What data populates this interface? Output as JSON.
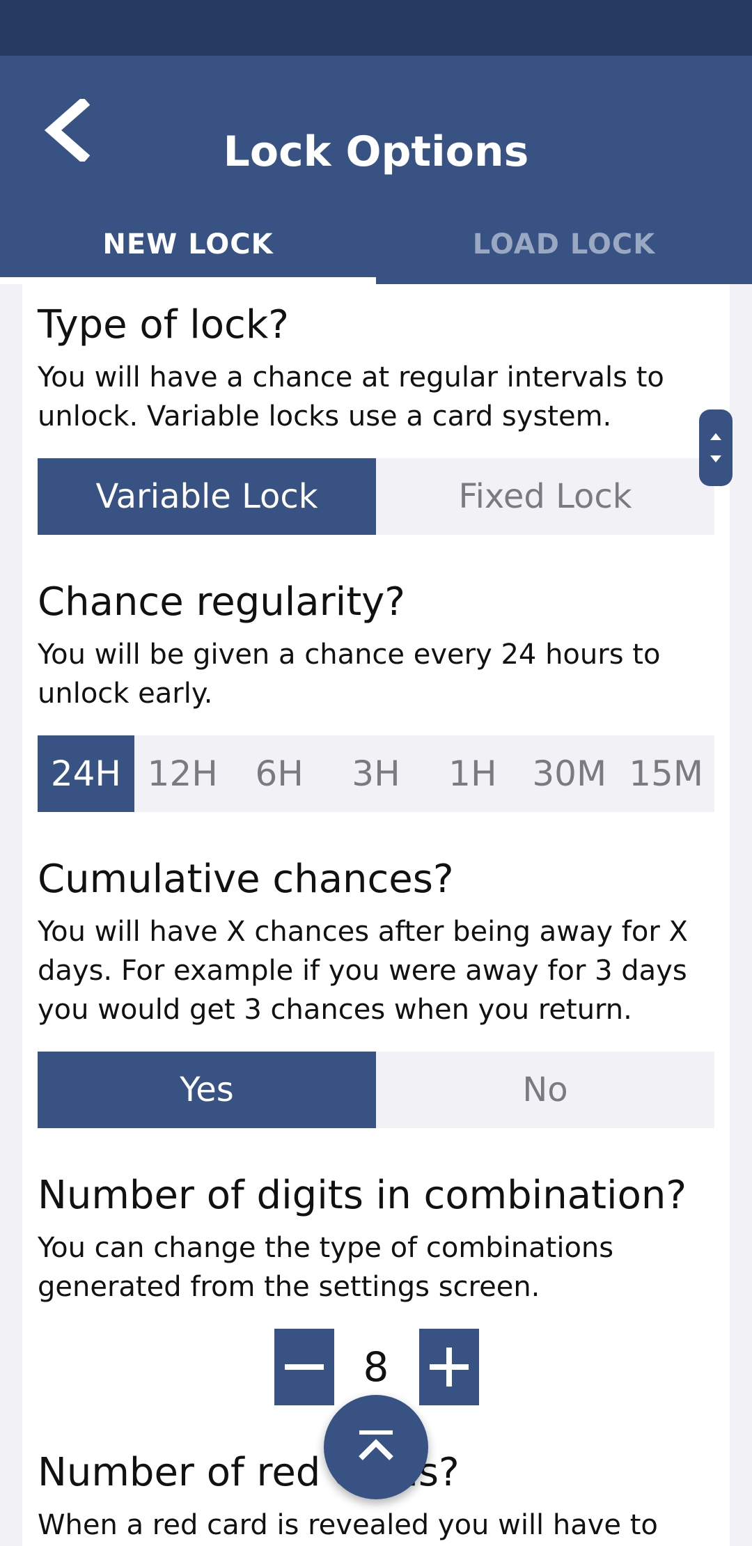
{
  "header": {
    "title": "Lock Options",
    "tabs": [
      {
        "label": "NEW LOCK",
        "active": true
      },
      {
        "label": "LOAD LOCK",
        "active": false
      }
    ]
  },
  "sections": {
    "type": {
      "title": "Type of lock?",
      "description": "You will have a chance at regular intervals to unlock. Variable locks use a card system.",
      "options": [
        "Variable Lock",
        "Fixed Lock"
      ],
      "selected": "Variable Lock"
    },
    "regularity": {
      "title": "Chance regularity?",
      "description": "You will be given a chance every 24 hours to unlock early.",
      "options": [
        "24H",
        "12H",
        "6H",
        "3H",
        "1H",
        "30M",
        "15M"
      ],
      "selected": "24H"
    },
    "cumulative": {
      "title": "Cumulative chances?",
      "description": "You will have X chances after being away for X days. For example if you were away for 3 days you would get 3 chances when you return.",
      "options": [
        "Yes",
        "No"
      ],
      "selected": "Yes"
    },
    "digits": {
      "title": "Number of digits in combination?",
      "description": "You can change the type of combinations generated from the settings screen.",
      "value": "8"
    },
    "red_cards": {
      "title": "Number of red cards?",
      "description": "When a red card is revealed you will have to wait"
    }
  },
  "colors": {
    "primary": "#375283",
    "status_bar": "#273a61",
    "segment_bg": "#f2f2f6",
    "inactive_tab": "#9aa8c2"
  },
  "icons": {
    "back": "chevron-left-icon",
    "decrement": "minus-icon",
    "increment": "plus-icon",
    "scroll_top": "scroll-to-top-icon",
    "scroll_handle": "scroll-handle-icon"
  }
}
